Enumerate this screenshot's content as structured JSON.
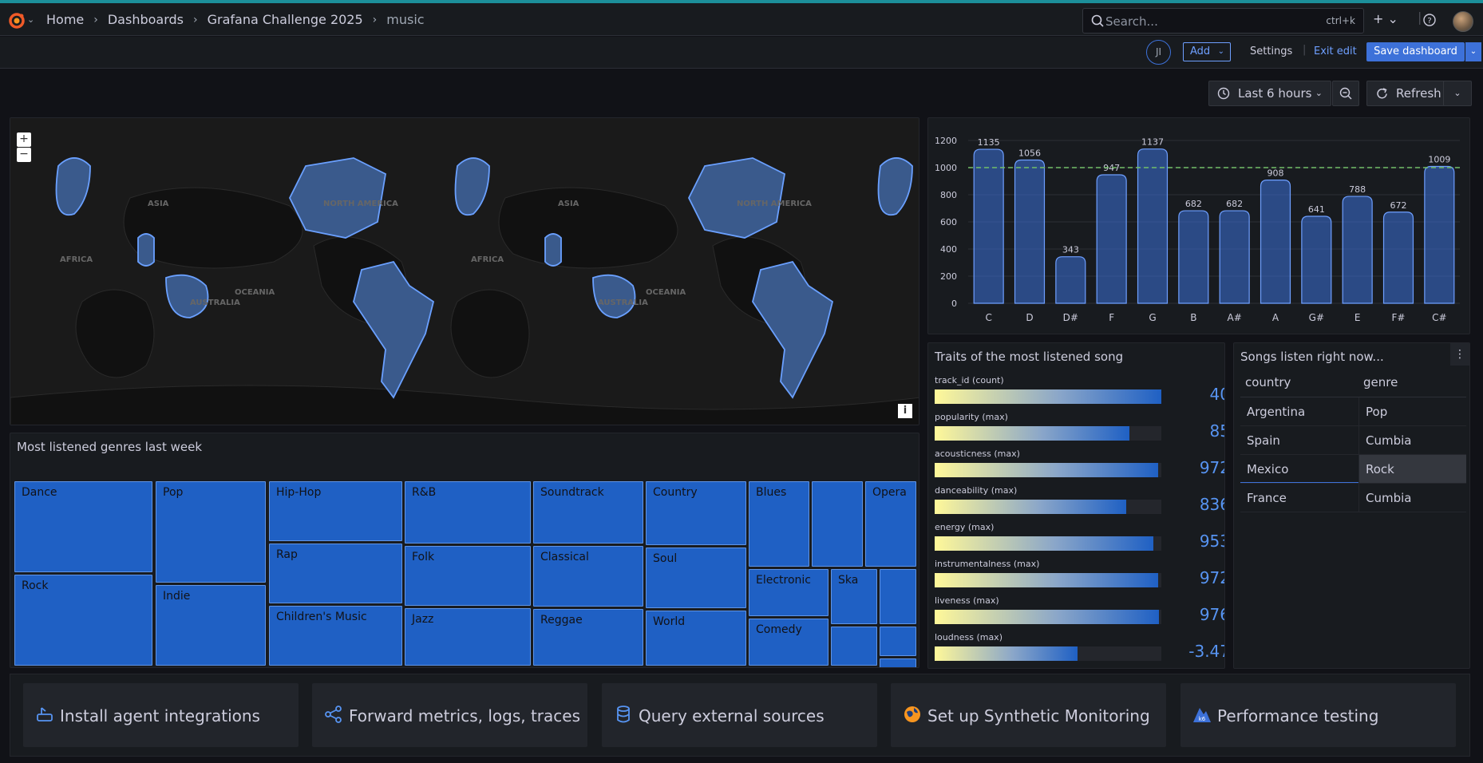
{
  "topbar": {
    "breadcrumbs": [
      "Home",
      "Dashboards",
      "Grafana Challenge 2025",
      "music"
    ],
    "search_placeholder": "Search...",
    "search_shortcut": "ctrl+k"
  },
  "toolbar": {
    "avatar_initials": "JI",
    "add_label": "Add",
    "settings_label": "Settings",
    "exit_edit_label": "Exit edit",
    "save_label": "Save dashboard"
  },
  "timebar": {
    "range_label": "Last 6 hours",
    "refresh_label": "Refresh"
  },
  "map_panel": {
    "zoom_in": "+",
    "zoom_out": "−",
    "info": "i",
    "labels": [
      "ASIA",
      "NORTH AMERICA",
      "AFRICA",
      "OCEANIA",
      "AUSTRALIA",
      "SOUTH AMERICA"
    ]
  },
  "bar_panel": {
    "chart_data": {
      "type": "bar",
      "categories": [
        "C",
        "D",
        "D#",
        "F",
        "G",
        "B",
        "A#",
        "A",
        "G#",
        "E",
        "F#",
        "C#"
      ],
      "values": [
        1135,
        1056,
        343,
        947,
        1137,
        682,
        682,
        908,
        641,
        788,
        672,
        1009
      ],
      "ylim": [
        0,
        1200
      ],
      "yticks": [
        0,
        200,
        400,
        600,
        800,
        1000,
        1200
      ],
      "threshold": 1000,
      "bar_color": "#3d71d9",
      "threshold_color": "#73bf69"
    }
  },
  "treemap_panel": {
    "title": "Most listened genres last week",
    "cells": [
      "Dance",
      "Rock",
      "Pop",
      "Indie",
      "Hip-Hop",
      "Rap",
      "Children's Music",
      "R&B",
      "Folk",
      "Jazz",
      "Soundtrack",
      "Classical",
      "Reggae",
      "Country",
      "Soul",
      "World",
      "Blues",
      "",
      "Opera",
      "Electronic",
      "Ska",
      "",
      "Comedy",
      "",
      "",
      ""
    ]
  },
  "gauge_panel": {
    "title": "Traits of the most listened song",
    "rows": [
      {
        "label": "track_id (count)",
        "value": "40",
        "fill": 1.0
      },
      {
        "label": "popularity (max)",
        "value": "85",
        "fill": 0.86
      },
      {
        "label": "acousticness (max)",
        "value": "972",
        "fill": 0.985
      },
      {
        "label": "danceability (max)",
        "value": "836",
        "fill": 0.845
      },
      {
        "label": "energy (max)",
        "value": "953",
        "fill": 0.965
      },
      {
        "label": "instrumentalness (max)",
        "value": "972",
        "fill": 0.985
      },
      {
        "label": "liveness (max)",
        "value": "976",
        "fill": 0.99
      },
      {
        "label": "loudness (max)",
        "value": "-3.47",
        "fill": 0.63
      }
    ]
  },
  "table_panel": {
    "title": "Songs listen right now...",
    "columns": [
      "country",
      "genre"
    ],
    "rows": [
      [
        "Argentina",
        "Pop"
      ],
      [
        "Spain",
        "Cumbia"
      ],
      [
        "Mexico",
        "Rock"
      ],
      [
        "France",
        "Cumbia"
      ]
    ]
  },
  "bottom_cards": [
    {
      "label": "Install agent integrations",
      "icon": "agent-icon"
    },
    {
      "label": "Forward metrics, logs, traces",
      "icon": "share-nodes-icon"
    },
    {
      "label": "Query external sources",
      "icon": "database-icon"
    },
    {
      "label": "Set up Synthetic Monitoring",
      "icon": "globe-icon"
    },
    {
      "label": "Performance testing",
      "icon": "k6-icon"
    }
  ]
}
